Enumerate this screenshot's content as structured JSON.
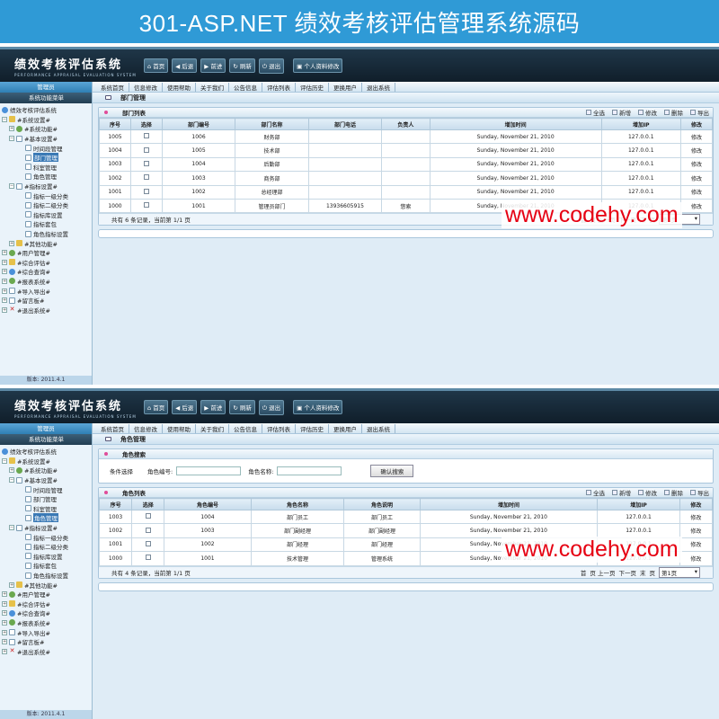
{
  "banner": {
    "title": "301-ASP.NET 绩效考核评估管理系统源码"
  },
  "watermark": "www.codehy.com",
  "app": {
    "logo_main": "绩效考核评估系统",
    "logo_sub": "PERFORMANCE APPRAISAL EVALUATION SYSTEM",
    "toolbar": {
      "home": "首页",
      "back": "后退",
      "forward": "前进",
      "refresh": "刷新",
      "exit": "退出",
      "personal": "个人资料修改"
    },
    "side": {
      "user": "管理员",
      "menu": "系统功能菜单",
      "root": "绩效考核评估系统",
      "footer": "版本: 2011.4.1"
    },
    "tree": {
      "sys": "#系统设置#",
      "func": "#系统功能#",
      "basic": "#基本设置#",
      "time": "时间段管理",
      "dept": "部门管理",
      "office": "科室管理",
      "role": "角色管理",
      "index": "#指标设置#",
      "ind1": "指标一级分类",
      "ind2": "指标二级分类",
      "indset": "指标库设置",
      "indpkg": "指标套包",
      "roleind": "角色指标设置",
      "other": "#其他功能#",
      "user": "#用户管理#",
      "comp_eval": "#综合评估#",
      "comp_query": "#综合查询#",
      "report": "#报表系统#",
      "io": "#导入导出#",
      "msg": "#留言板#",
      "exit": "#退出系统#"
    },
    "nav": [
      "系统首页",
      "信息修改",
      "使用帮助",
      "关于我们",
      "公告信息",
      "评估列表",
      "评估历史",
      "更换用户",
      "退出系统"
    ],
    "actions": {
      "all": "全选",
      "add": "新增",
      "edit": "修改",
      "del": "删除",
      "export": "导出"
    },
    "pager": {
      "first": "首",
      "prev": "页 上一页",
      "next": "下一页",
      "last": "末",
      "page": "页",
      "select": "第1页"
    }
  },
  "screen1": {
    "page_title": "部门管理",
    "panel_title": "部门列表",
    "columns": [
      "序号",
      "选择",
      "部门编号",
      "部门名称",
      "部门电话",
      "负责人",
      "增加时间",
      "增加IP",
      "修改"
    ],
    "rows": [
      [
        "1005",
        "",
        "1006",
        "财务部",
        "",
        "",
        "Sunday, November 21, 2010",
        "127.0.0.1",
        "修改"
      ],
      [
        "1004",
        "",
        "1005",
        "技术部",
        "",
        "",
        "Sunday, November 21, 2010",
        "127.0.0.1",
        "修改"
      ],
      [
        "1003",
        "",
        "1004",
        "后勤部",
        "",
        "",
        "Sunday, November 21, 2010",
        "127.0.0.1",
        "修改"
      ],
      [
        "1002",
        "",
        "1003",
        "商务部",
        "",
        "",
        "Sunday, November 21, 2010",
        "127.0.0.1",
        "修改"
      ],
      [
        "1001",
        "",
        "1002",
        "总经理部",
        "",
        "",
        "Sunday, November 21, 2010",
        "127.0.0.1",
        "修改"
      ],
      [
        "1000",
        "",
        "1001",
        "管理员部门",
        "13936605915",
        "悠索",
        "Sunday, November 21, 2010",
        "127.0.0.1",
        "修改"
      ]
    ],
    "pager_info": "共有 6 条记录，当前第 1/1 页"
  },
  "screen2": {
    "page_title": "角色管理",
    "search_title": "角色搜索",
    "cond_label": "条件选择",
    "role_id_label": "角色编号:",
    "role_name_label": "角色名称:",
    "search_btn": "确认搜索",
    "panel_title": "角色列表",
    "columns": [
      "序号",
      "选择",
      "角色编号",
      "角色名称",
      "角色说明",
      "增加时间",
      "增加IP",
      "修改"
    ],
    "rows": [
      [
        "1003",
        "",
        "1004",
        "部门员工",
        "部门员工",
        "Sunday, November 21, 2010",
        "127.0.0.1",
        "修改"
      ],
      [
        "1002",
        "",
        "1003",
        "部门副经理",
        "部门副经理",
        "Sunday, November 21, 2010",
        "127.0.0.1",
        "修改"
      ],
      [
        "1001",
        "",
        "1002",
        "部门经理",
        "部门经理",
        "Sunday, November 21, 2010",
        "127.0.0.1",
        "修改"
      ],
      [
        "1000",
        "",
        "1001",
        "技术管理",
        "管理系统",
        "Sunday, November 21, 2010",
        "127.0.0.1",
        "修改"
      ]
    ],
    "pager_info": "共有 4 条记录，当前第 1/1 页"
  }
}
